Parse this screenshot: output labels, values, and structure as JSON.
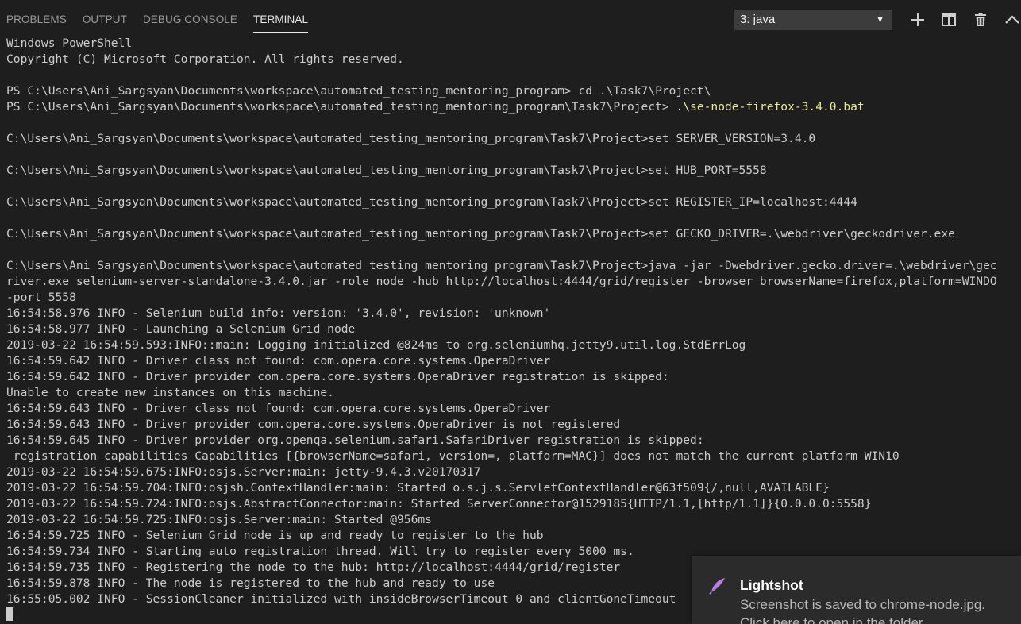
{
  "panel": {
    "tabs": [
      {
        "label": "PROBLEMS",
        "active": false
      },
      {
        "label": "OUTPUT",
        "active": false
      },
      {
        "label": "DEBUG CONSOLE",
        "active": false
      },
      {
        "label": "TERMINAL",
        "active": true
      }
    ],
    "terminal_selector": {
      "value": "3: java"
    },
    "icons": [
      "plus-icon",
      "split-terminal-icon",
      "trash-icon",
      "chevron-up-icon"
    ]
  },
  "terminal": {
    "lines": [
      {
        "text": "Windows PowerShell"
      },
      {
        "text": "Copyright (C) Microsoft Corporation. All rights reserved."
      },
      {
        "text": ""
      },
      {
        "text": "PS C:\\Users\\Ani_Sargsyan\\Documents\\workspace\\automated_testing_mentoring_program> cd .\\Task7\\Project\\"
      },
      {
        "text": "PS C:\\Users\\Ani_Sargsyan\\Documents\\workspace\\automated_testing_mentoring_program\\Task7\\Project> ",
        "cmd": ".\\se-node-firefox-3.4.0.bat"
      },
      {
        "text": ""
      },
      {
        "text": "C:\\Users\\Ani_Sargsyan\\Documents\\workspace\\automated_testing_mentoring_program\\Task7\\Project>set SERVER_VERSION=3.4.0"
      },
      {
        "text": ""
      },
      {
        "text": "C:\\Users\\Ani_Sargsyan\\Documents\\workspace\\automated_testing_mentoring_program\\Task7\\Project>set HUB_PORT=5558"
      },
      {
        "text": ""
      },
      {
        "text": "C:\\Users\\Ani_Sargsyan\\Documents\\workspace\\automated_testing_mentoring_program\\Task7\\Project>set REGISTER_IP=localhost:4444"
      },
      {
        "text": ""
      },
      {
        "text": "C:\\Users\\Ani_Sargsyan\\Documents\\workspace\\automated_testing_mentoring_program\\Task7\\Project>set GECKO_DRIVER=.\\webdriver\\geckodriver.exe"
      },
      {
        "text": ""
      },
      {
        "text": "C:\\Users\\Ani_Sargsyan\\Documents\\workspace\\automated_testing_mentoring_program\\Task7\\Project>java -jar -Dwebdriver.gecko.driver=.\\webdriver\\gec"
      },
      {
        "text": "river.exe selenium-server-standalone-3.4.0.jar -role node -hub http://localhost:4444/grid/register -browser browserName=firefox,platform=WINDO"
      },
      {
        "text": "-port 5558"
      },
      {
        "text": "16:54:58.976 INFO - Selenium build info: version: '3.4.0', revision: 'unknown'"
      },
      {
        "text": "16:54:58.977 INFO - Launching a Selenium Grid node"
      },
      {
        "text": "2019-03-22 16:54:59.593:INFO::main: Logging initialized @824ms to org.seleniumhq.jetty9.util.log.StdErrLog"
      },
      {
        "text": "16:54:59.642 INFO - Driver class not found: com.opera.core.systems.OperaDriver"
      },
      {
        "text": "16:54:59.642 INFO - Driver provider com.opera.core.systems.OperaDriver registration is skipped:"
      },
      {
        "text": "Unable to create new instances on this machine."
      },
      {
        "text": "16:54:59.643 INFO - Driver class not found: com.opera.core.systems.OperaDriver"
      },
      {
        "text": "16:54:59.643 INFO - Driver provider com.opera.core.systems.OperaDriver is not registered"
      },
      {
        "text": "16:54:59.645 INFO - Driver provider org.openqa.selenium.safari.SafariDriver registration is skipped:"
      },
      {
        "text": " registration capabilities Capabilities [{browserName=safari, version=, platform=MAC}] does not match the current platform WIN10"
      },
      {
        "text": "2019-03-22 16:54:59.675:INFO:osjs.Server:main: jetty-9.4.3.v20170317"
      },
      {
        "text": "2019-03-22 16:54:59.704:INFO:osjsh.ContextHandler:main: Started o.s.j.s.ServletContextHandler@63f509{/,null,AVAILABLE}"
      },
      {
        "text": "2019-03-22 16:54:59.724:INFO:osjs.AbstractConnector:main: Started ServerConnector@1529185{HTTP/1.1,[http/1.1]}{0.0.0.0:5558}"
      },
      {
        "text": "2019-03-22 16:54:59.725:INFO:osjs.Server:main: Started @956ms"
      },
      {
        "text": "16:54:59.725 INFO - Selenium Grid node is up and ready to register to the hub"
      },
      {
        "text": "16:54:59.734 INFO - Starting auto registration thread. Will try to register every 5000 ms."
      },
      {
        "text": "16:54:59.735 INFO - Registering the node to the hub: http://localhost:4444/grid/register"
      },
      {
        "text": "16:54:59.878 INFO - The node is registered to the hub and ready to use"
      },
      {
        "text": "16:55:05.002 INFO - SessionCleaner initialized with insideBrowserTimeout 0 and clientGoneTimeout"
      }
    ]
  },
  "notification": {
    "app": "Lightshot",
    "message": "Screenshot is saved to chrome-node.jpg.",
    "action": "Click here to open in the folder."
  },
  "colors": {
    "background": "#1e1e1e",
    "text": "#cccccc",
    "command": "#e8e8a0",
    "lightshot_icon": "#b77fe0"
  }
}
